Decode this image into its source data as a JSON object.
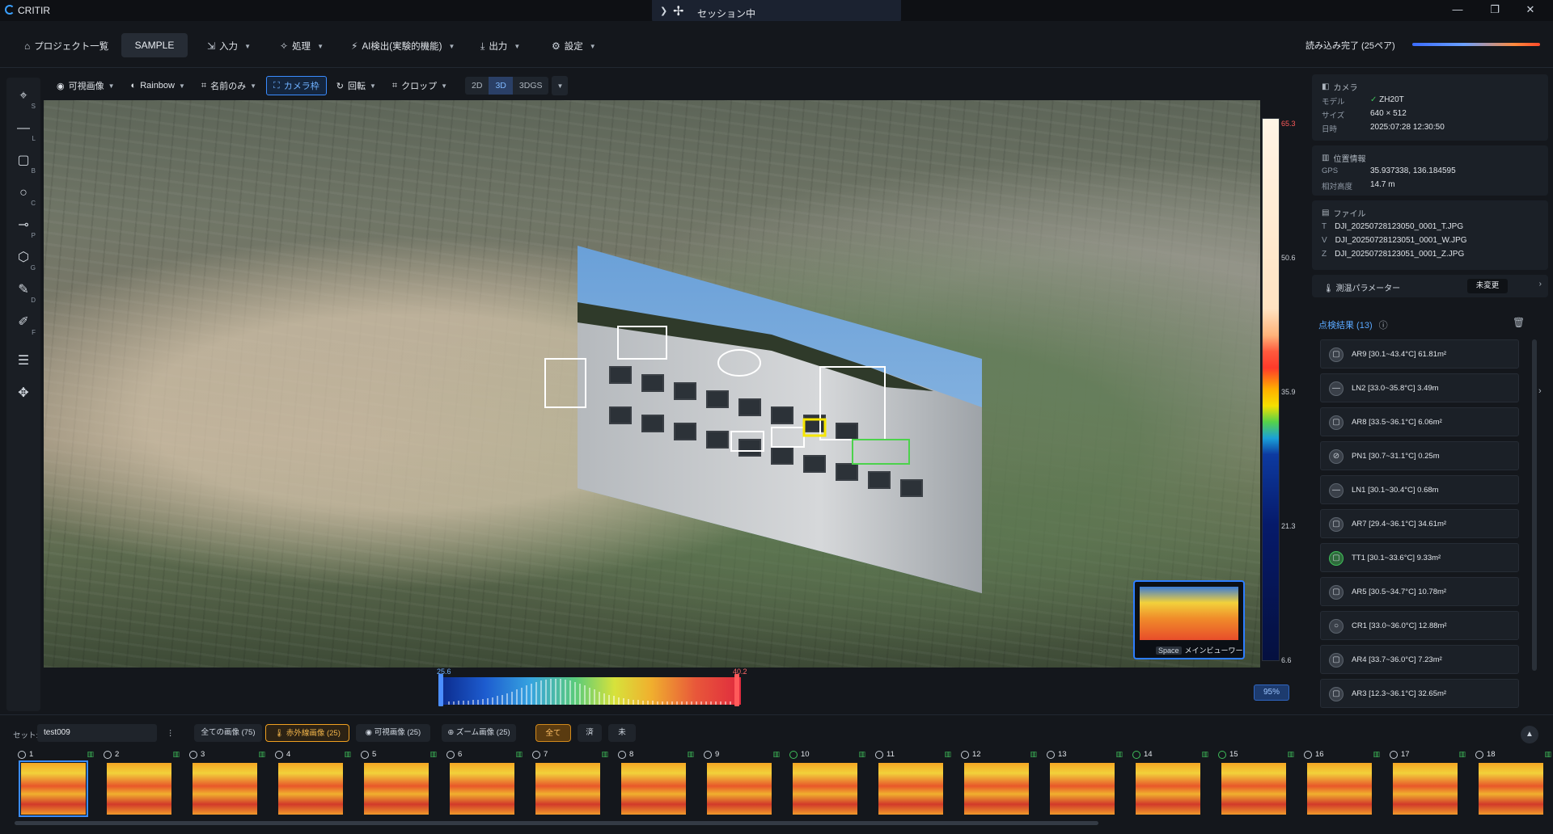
{
  "app": {
    "name": "CRITIR",
    "session": "セッション中"
  },
  "menu": {
    "projects": "プロジェクト一覧",
    "sample": "SAMPLE",
    "input": "入力",
    "process": "処理",
    "ai": "AI検出(実験的機能)",
    "output": "出力",
    "settings": "設定",
    "load_status": "読み込み完了 (25ペア)"
  },
  "viewtools": {
    "visible": "可視画像",
    "palette": "Rainbow",
    "name_only": "名前のみ",
    "camera_frame": "カメラ枠",
    "rotate": "回転",
    "crop": "クロップ",
    "mode_2d": "2D",
    "mode_3d": "3D",
    "mode_3dgs": "3DGS"
  },
  "left_tools": [
    {
      "icon": "crosshair-icon",
      "key": "S",
      "glyph": "⌖"
    },
    {
      "icon": "line-icon",
      "key": "L",
      "glyph": "—"
    },
    {
      "icon": "box-icon",
      "key": "B",
      "glyph": "▢"
    },
    {
      "icon": "circle-icon",
      "key": "C",
      "glyph": "○"
    },
    {
      "icon": "point-icon",
      "key": "P",
      "glyph": "⊸"
    },
    {
      "icon": "polygon-icon",
      "key": "G",
      "glyph": "⬡"
    },
    {
      "icon": "draw-icon",
      "key": "D",
      "glyph": "✎"
    },
    {
      "icon": "edit-icon",
      "key": "F",
      "glyph": "✐"
    },
    {
      "icon": "sliders-icon",
      "key": "",
      "glyph": "☰"
    },
    {
      "icon": "move-icon",
      "key": "",
      "glyph": "✥"
    }
  ],
  "colorbar": {
    "ticks": [
      "65.3",
      "50.6",
      "35.9",
      "21.3",
      "6.6"
    ]
  },
  "histogram": {
    "low": "25.6",
    "high": "40.2"
  },
  "zoom": "95%",
  "minimap": {
    "key": "Space",
    "label": "メインビューワー"
  },
  "camera": {
    "title": "カメラ",
    "model_label": "モデル",
    "model": "ZH20T",
    "size_label": "サイズ",
    "size": "640 × 512",
    "date_label": "日時",
    "date": "2025:07:28 12:30:50"
  },
  "location": {
    "title": "位置情報",
    "gps_label": "GPS",
    "gps": "35.937338, 136.184595",
    "alt_label": "相対高度",
    "alt": "14.7 m"
  },
  "file": {
    "title": "ファイル",
    "t_prefix": "T",
    "t": "DJI_20250728123050_0001_T.JPG",
    "v_prefix": "V",
    "v": "DJI_20250728123051_0001_W.JPG",
    "z_prefix": "Z",
    "z": "DJI_20250728123051_0001_Z.JPG"
  },
  "param": {
    "label": "測温パラメーター",
    "button": "未変更"
  },
  "results": {
    "title": "点検結果 (13)",
    "items": [
      {
        "text": "AR9 [30.1~43.4°C] 61.81m²",
        "icon": "▢",
        "green": false
      },
      {
        "text": "LN2 [33.0~35.8°C] 3.49m",
        "icon": "—",
        "green": false
      },
      {
        "text": "AR8 [33.5~36.1°C] 6.06m²",
        "icon": "▢",
        "green": false
      },
      {
        "text": "PN1 [30.7~31.1°C] 0.25m",
        "icon": "⊘",
        "green": false
      },
      {
        "text": "LN1 [30.1~30.4°C] 0.68m",
        "icon": "—",
        "green": false
      },
      {
        "text": "AR7 [29.4~36.1°C] 34.61m²",
        "icon": "▢",
        "green": false
      },
      {
        "text": "TT1 [30.1~33.6°C] 9.33m²",
        "icon": "▢",
        "green": true
      },
      {
        "text": "AR5 [30.5~34.7°C] 10.78m²",
        "icon": "▢",
        "green": false
      },
      {
        "text": "CR1 [33.0~36.0°C] 12.88m²",
        "icon": "○",
        "green": false
      },
      {
        "text": "AR4 [33.7~36.0°C] 7.23m²",
        "icon": "▢",
        "green": false
      },
      {
        "text": "AR3 [12.3~36.1°C] 32.65m²",
        "icon": "▢",
        "green": false
      }
    ]
  },
  "bottom": {
    "set_label": "セット:",
    "set_value": "test009",
    "all_images": "全ての画像 (75)",
    "ir_images": "赤外線画像 (25)",
    "visible_images": "可視画像 (25)",
    "zoom_images": "ズーム画像 (25)",
    "filter_all": "全て",
    "filter_done": "済",
    "filter_pending": "未"
  },
  "thumbnails": [
    {
      "n": "1",
      "ok": false
    },
    {
      "n": "2",
      "ok": false
    },
    {
      "n": "3",
      "ok": false
    },
    {
      "n": "4",
      "ok": false
    },
    {
      "n": "5",
      "ok": false
    },
    {
      "n": "6",
      "ok": false
    },
    {
      "n": "7",
      "ok": false
    },
    {
      "n": "8",
      "ok": false
    },
    {
      "n": "9",
      "ok": false
    },
    {
      "n": "10",
      "ok": true
    },
    {
      "n": "11",
      "ok": false
    },
    {
      "n": "12",
      "ok": false
    },
    {
      "n": "13",
      "ok": false
    },
    {
      "n": "14",
      "ok": true
    },
    {
      "n": "15",
      "ok": true
    },
    {
      "n": "16",
      "ok": false
    },
    {
      "n": "17",
      "ok": false
    },
    {
      "n": "18",
      "ok": false
    }
  ]
}
